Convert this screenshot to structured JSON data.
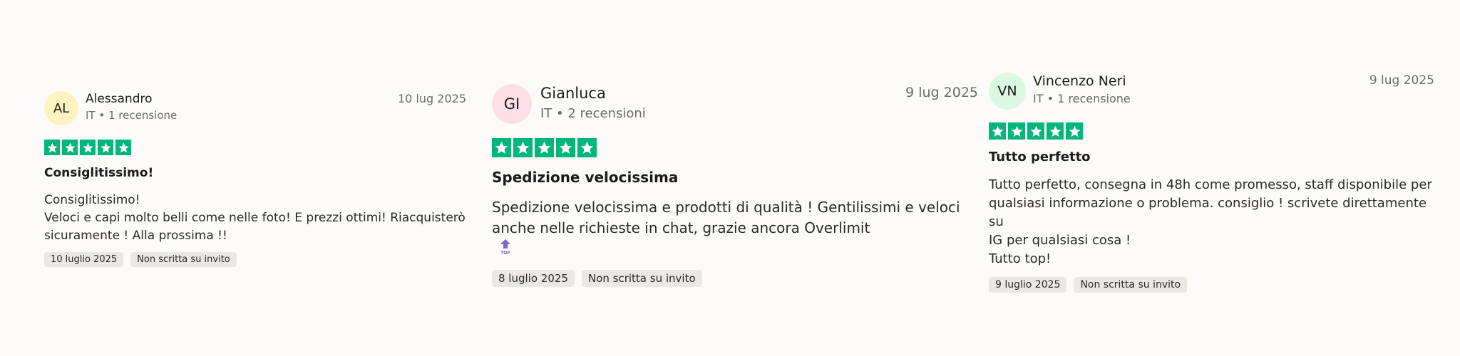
{
  "colors": {
    "star_bg": "#00b67a",
    "tag_bg": "#eae8e3",
    "avatar_al": "#fef3c0",
    "avatar_gi": "#fde0e6",
    "avatar_vn": "#dcf7e2"
  },
  "reviews": [
    {
      "initials": "AL",
      "name": "Alessandro",
      "meta": "IT • 1 recensione",
      "date": "10 lug 2025",
      "rating": 5,
      "title": "Consiglitissimo!",
      "body_lines": [
        "Consiglitissimo!",
        "Veloci e capi molto belli come nelle foto! E prezzi ottimi! Riacquisterò",
        "sicuramente ! Alla prossima !!"
      ],
      "experience_date": "10 luglio 2025",
      "invite_label": "Non scritta su invito"
    },
    {
      "initials": "GI",
      "name": "Gianluca",
      "meta": "IT • 2 recensioni",
      "date": "9 lug 2025",
      "rating": 5,
      "title": "Spedizione velocissima",
      "body_lines": [
        "Spedizione velocissima e prodotti di qualità ! Gentilissimi e veloci",
        "anche nelle richieste in chat, grazie ancora Overlimit"
      ],
      "body_icon": "top-arrow-icon",
      "body_icon_label": "TOP",
      "experience_date": "8 luglio 2025",
      "invite_label": "Non scritta su invito"
    },
    {
      "initials": "VN",
      "name": "Vincenzo Neri",
      "meta": "IT • 1 recensione",
      "date": "9 lug 2025",
      "rating": 5,
      "title": "Tutto perfetto",
      "body_lines": [
        "Tutto perfetto, consegna in 48h come promesso, staff disponibile per",
        "qualsiasi informazione o problema. consiglio ! scrivete direttamente su",
        "IG per qualsiasi cosa !",
        "Tutto top!"
      ],
      "experience_date": "9 luglio 2025",
      "invite_label": "Non scritta su invito"
    }
  ]
}
